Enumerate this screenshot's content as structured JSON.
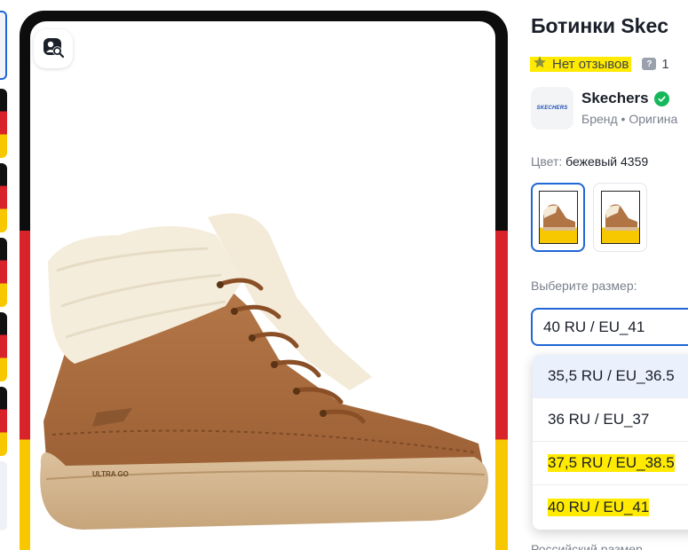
{
  "product": {
    "title": "Ботинки Skec",
    "rating_text": "Нет отзывов",
    "questions_count": "1"
  },
  "brand": {
    "logo_text": "SKECHERS",
    "name": "Skechers",
    "subtitle": "Бренд • Оригина"
  },
  "color": {
    "label": "Цвет:",
    "value": "бежевый 4359"
  },
  "size": {
    "label": "Выберите размер:",
    "selected": "40 RU / EU_41",
    "options": [
      "35,5 RU / EU_36.5",
      "36 RU / EU_37",
      "37,5 RU / EU_38.5",
      "40 RU / EU_41"
    ],
    "below_label": "Российский размер"
  },
  "boot_labels": {
    "insole": "ULTRA GO"
  },
  "colors": {
    "accent": "#1f66d6",
    "highlight": "#ffea00",
    "verified": "#14b85a",
    "stripe_black": "#0d0d0d",
    "stripe_red": "#d8232a",
    "stripe_gold": "#f7c800"
  },
  "icons": {
    "lens": "image-search-icon",
    "star": "star-icon",
    "question": "question-icon",
    "verified": "verified-check-icon"
  }
}
